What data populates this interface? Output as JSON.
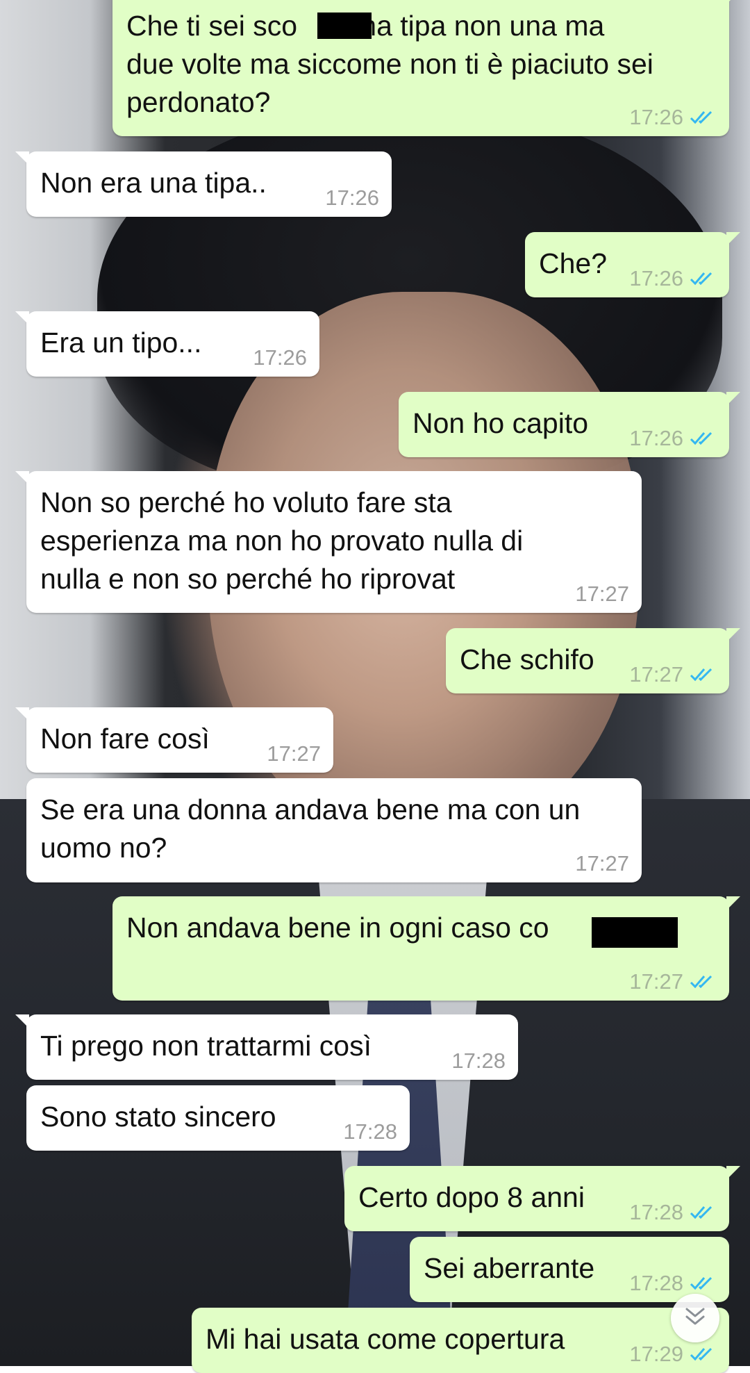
{
  "messages": [
    {
      "direction": "out",
      "text": "Che ti sei sco   o una tipa non una ma\ndue volte ma siccome non ti è piaciuto sei\nperdonato?",
      "time": "17:26",
      "status": "read"
    },
    {
      "direction": "in",
      "text": "Non era una tipa..",
      "time": "17:26"
    },
    {
      "direction": "out",
      "text": "Che?",
      "time": "17:26",
      "status": "read"
    },
    {
      "direction": "in",
      "text": "Era un tipo...",
      "time": "17:26"
    },
    {
      "direction": "out",
      "text": "Non ho capito",
      "time": "17:26",
      "status": "read"
    },
    {
      "direction": "in",
      "text": "Non so perché ho voluto fare sta\nesperienza ma non ho provato nulla di\nnulla e non so perché ho riprovat",
      "time": "17:27"
    },
    {
      "direction": "out",
      "text": "Che schifo",
      "time": "17:27",
      "status": "read"
    },
    {
      "direction": "in",
      "text": "Non fare così",
      "time": "17:27"
    },
    {
      "direction": "in",
      "text": "Se era una donna andava bene ma con un\nuomo no?",
      "time": "17:27"
    },
    {
      "direction": "out",
      "text": "Non andava bene in ogni caso co",
      "time": "17:27",
      "status": "read"
    },
    {
      "direction": "in",
      "text": "Ti prego non trattarmi così",
      "time": "17:28"
    },
    {
      "direction": "in",
      "text": "Sono stato sincero",
      "time": "17:28"
    },
    {
      "direction": "out",
      "text": "Certo dopo 8 anni",
      "time": "17:28",
      "status": "read"
    },
    {
      "direction": "out",
      "text": "Sei aberrante",
      "time": "17:28",
      "status": "read"
    },
    {
      "direction": "out",
      "text": "Mi hai usata come copertura",
      "time": "17:29",
      "status": "read"
    }
  ],
  "icons": {
    "read_receipt": "double-check-icon",
    "scroll_down": "chevron-double-down-icon"
  },
  "colors": {
    "outgoing_bubble": "#e1fec6",
    "incoming_bubble": "#ffffff",
    "read_ticks": "#34b7f1",
    "timestamp": "#9c9c9c"
  }
}
